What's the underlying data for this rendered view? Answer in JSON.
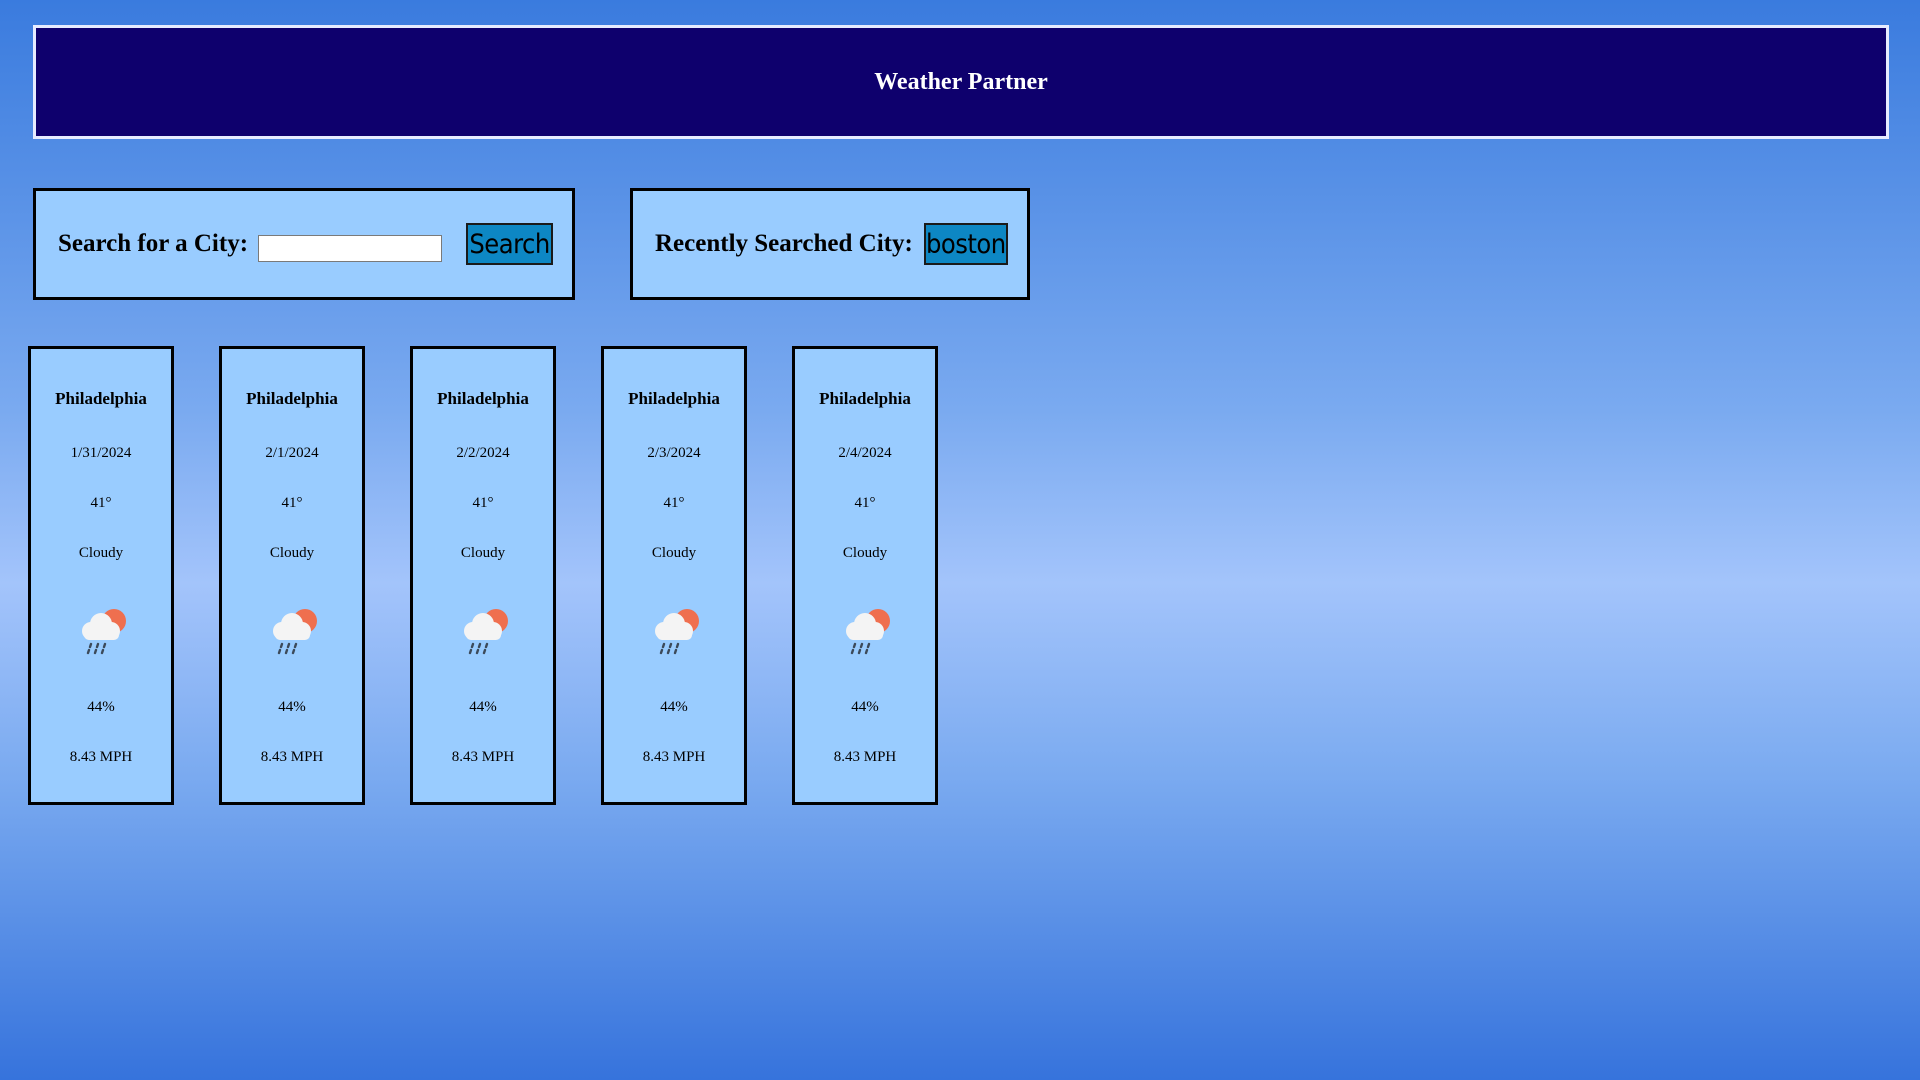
{
  "header": {
    "title": "Weather Partner"
  },
  "search": {
    "label": "Search for a City:",
    "input_value": "",
    "placeholder": "",
    "button_label": "Search"
  },
  "recent": {
    "label": "Recently Searched City:",
    "city_button_label": "boston"
  },
  "forecast": [
    {
      "city": "Philadelphia",
      "date": "1/31/2024",
      "temp": "41°",
      "condition": "Cloudy",
      "icon": "cloud-rain-sun-icon",
      "humidity": "44%",
      "wind": "8.43 MPH"
    },
    {
      "city": "Philadelphia",
      "date": "2/1/2024",
      "temp": "41°",
      "condition": "Cloudy",
      "icon": "cloud-rain-sun-icon",
      "humidity": "44%",
      "wind": "8.43 MPH"
    },
    {
      "city": "Philadelphia",
      "date": "2/2/2024",
      "temp": "41°",
      "condition": "Cloudy",
      "icon": "cloud-rain-sun-icon",
      "humidity": "44%",
      "wind": "8.43 MPH"
    },
    {
      "city": "Philadelphia",
      "date": "2/3/2024",
      "temp": "41°",
      "condition": "Cloudy",
      "icon": "cloud-rain-sun-icon",
      "humidity": "44%",
      "wind": "8.43 MPH"
    },
    {
      "city": "Philadelphia",
      "date": "2/4/2024",
      "temp": "41°",
      "condition": "Cloudy",
      "icon": "cloud-rain-sun-icon",
      "humidity": "44%",
      "wind": "8.43 MPH"
    }
  ],
  "colors": {
    "header_bg": "#0e006d",
    "panel_bg": "#99ccff",
    "button_bg": "#0d87c4",
    "sun": "#ef6f4f"
  }
}
